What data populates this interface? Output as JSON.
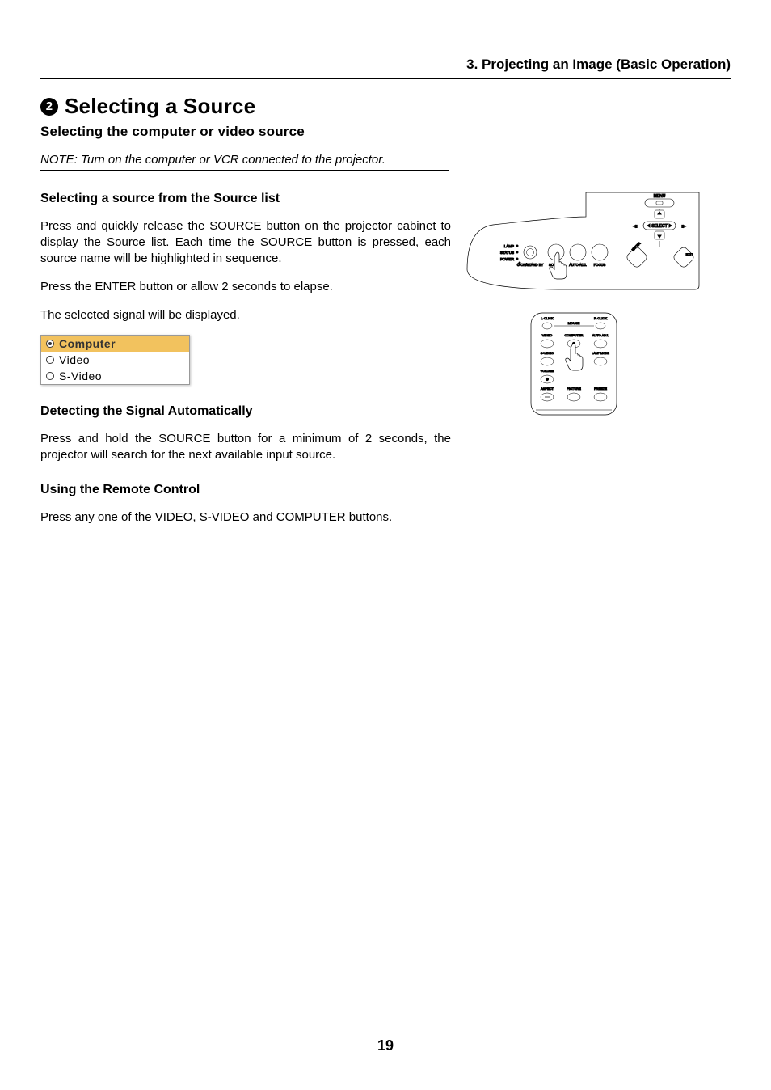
{
  "chapter": "3. Projecting an Image (Basic Operation)",
  "section_number": "2",
  "section_title": "Selecting a Source",
  "subsection_title": "Selecting the computer or video source",
  "note": "NOTE: Turn on the computer or VCR connected to the projector.",
  "blocks": {
    "a": {
      "heading": "Selecting a source from the Source list",
      "p1": "Press and quickly release the SOURCE button on the projector cabinet to display the Source list. Each time the SOURCE button is pressed, each source name will be highlighted in sequence.",
      "p2": "Press the ENTER button or allow 2 seconds to elapse.",
      "p3": "The selected signal will be displayed."
    },
    "b": {
      "heading": "Detecting the Signal Automatically",
      "p1": "Press and hold the SOURCE button for a minimum of 2 seconds, the projector will search for the next available input source."
    },
    "c": {
      "heading": "Using the Remote Control",
      "p1": "Press any one of the VIDEO, S-VIDEO and COMPUTER buttons."
    }
  },
  "source_list": {
    "items": [
      {
        "label": "Computer",
        "selected": true
      },
      {
        "label": "Video",
        "selected": false
      },
      {
        "label": "S-Video",
        "selected": false
      }
    ]
  },
  "cabinet": {
    "labels": {
      "menu": "MENU",
      "select": "SELECT",
      "enter": "ENTER",
      "exit": "EXIT",
      "lamp": "LAMP",
      "status": "STATUS",
      "power": "POWER",
      "standby": "ON/STAND BY",
      "source": "SOURCE",
      "auto": "AUTO ADJ.",
      "focus": "FOCUS"
    }
  },
  "remote": {
    "labels": {
      "lclick": "L-CLICK",
      "rclick": "R-CLICK",
      "mouse": "MOUSE",
      "video": "VIDEO",
      "computer": "COMPUTER",
      "autoadj": "AUTO ADJ.",
      "svideo": "S-VIDEO",
      "lamp_mode": "LAMP MODE",
      "volume": "VOLUME",
      "aspect": "ASPECT",
      "picture": "PICTURE",
      "freeze": "FREEZE"
    }
  },
  "page_number": "19"
}
